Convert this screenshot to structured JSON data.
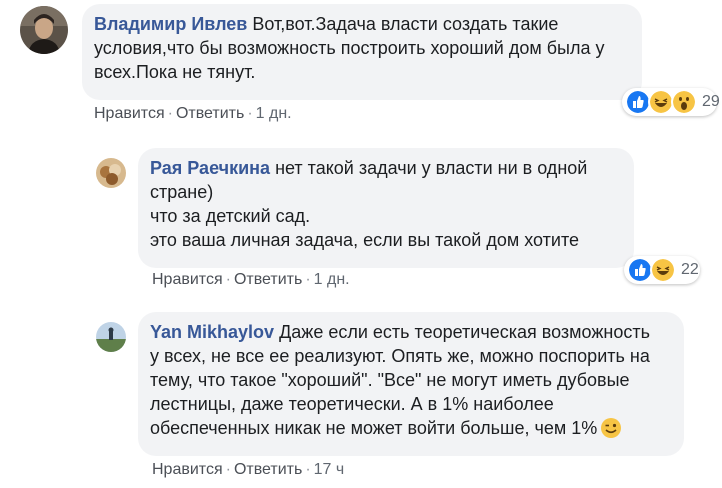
{
  "comments": [
    {
      "author": "Владимир Ивлев",
      "text_lines": [
        "Вот,вот.Задача власти создать такие",
        "условия,что бы возможность построить хороший дом была у",
        "всех.Пока не тянут."
      ],
      "actions": {
        "like": "Нравится",
        "reply": "Ответить",
        "time": "1 дн."
      },
      "reactions": {
        "icons": [
          "like-icon",
          "haha-icon",
          "wow-icon"
        ],
        "count": "29"
      }
    },
    {
      "author": "Рая Раечкина",
      "text_lines": [
        "нет такой задачи у власти ни в одной",
        "стране)",
        "что за детский сад.",
        "это ваша личная задача, если вы такой дом хотите"
      ],
      "actions": {
        "like": "Нравится",
        "reply": "Ответить",
        "time": "1 дн."
      },
      "reactions": {
        "icons": [
          "like-icon",
          "haha-icon"
        ],
        "count": "22"
      }
    },
    {
      "author": "Yan Mikhaylov",
      "text_lines": [
        "Даже если есть теоретическая возможность",
        "у всех, не все ее реализуют. Опять же, можно поспорить на",
        "тему, что такое \"хороший\". \"Все\" не могут иметь дубовые",
        "лестницы, даже теоретически. А в 1% наиболее",
        "обеспеченных никак не может войти больше, чем 1%"
      ],
      "actions": {
        "like": "Нравится",
        "reply": "Ответить",
        "time": "17 ч"
      }
    }
  ],
  "separator": "·",
  "colors": {
    "author": "#385898",
    "bubble": "#f2f3f5",
    "like_blue": "#1877f2",
    "emoji_yellow": "#f7c444"
  }
}
